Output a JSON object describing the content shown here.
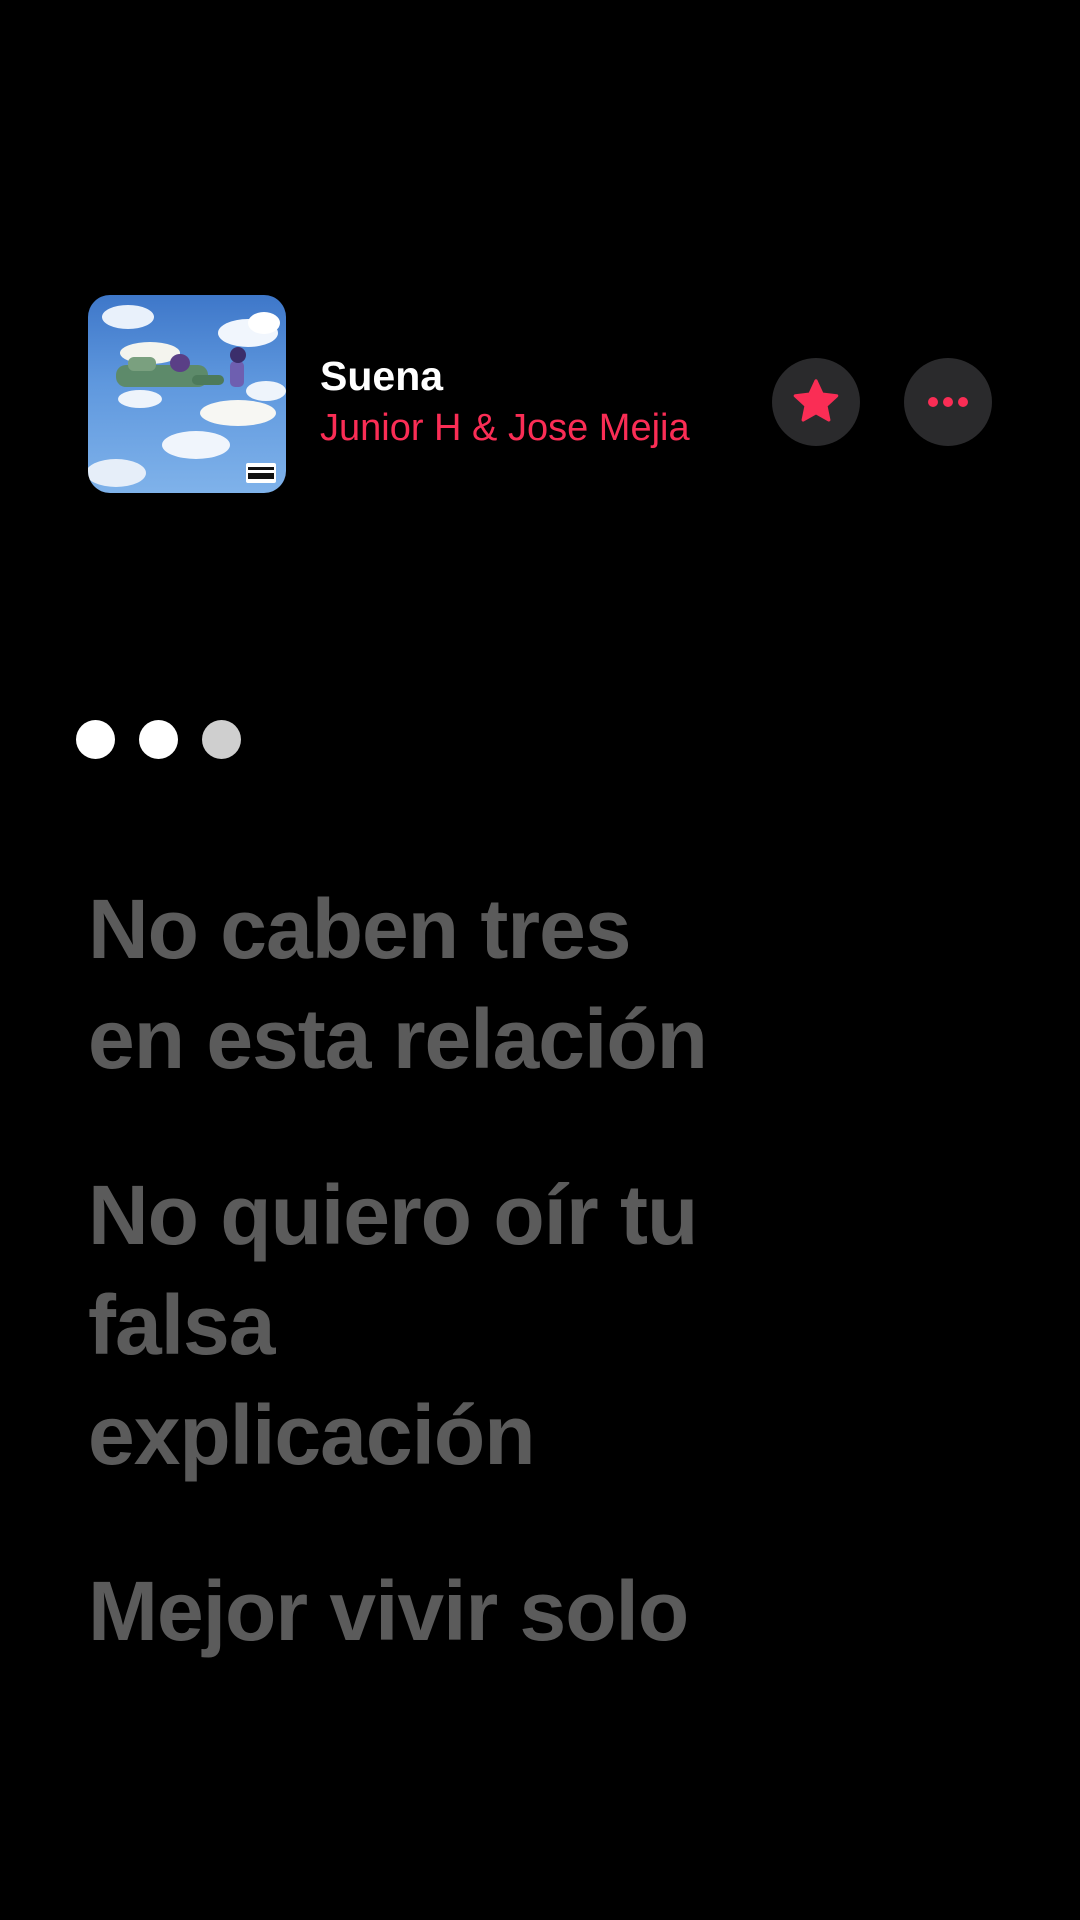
{
  "now_playing": {
    "title": "Suena",
    "artist": "Junior H & Jose Mejia",
    "artwork_icon": "album-artwork",
    "accent_color": "#fa2d55"
  },
  "actions": {
    "favorite_icon": "star-icon",
    "more_icon": "ellipsis-icon"
  },
  "lyrics": {
    "interlude_dots": 3,
    "lines": [
      [
        "No caben tres",
        "en esta relación"
      ],
      [
        "No quiero oír tu",
        "falsa",
        "explicación"
      ],
      [
        "Mejor vivir solo"
      ]
    ]
  }
}
